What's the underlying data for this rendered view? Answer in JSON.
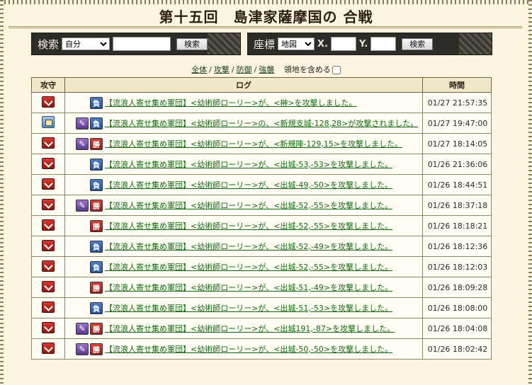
{
  "title": "第十五回　島津家薩摩国の 合戦",
  "search": {
    "label": "検索",
    "select_value": "自分",
    "select_options": [
      "自分"
    ],
    "text_value": "",
    "button": "検索"
  },
  "coords": {
    "label": "座標",
    "select_value": "地図",
    "select_options": [
      "地図"
    ],
    "x_label": "X.",
    "x_value": "",
    "y_label": "Y.",
    "y_value": "",
    "button": "検索"
  },
  "filters": {
    "all": "全体",
    "attack": "攻撃",
    "defense": "防御",
    "recon": "強襲",
    "include_territory": "領地を含める",
    "sep": "/"
  },
  "table": {
    "headers": {
      "kind": "攻守",
      "log": "ログ",
      "time": "時間"
    },
    "rows": [
      {
        "kind": "attack",
        "badges": [
          "負"
        ],
        "text": "【流浪人寄せ集め軍団】<幼術師ローリー>が、<榊>を攻撃しました。",
        "time": "01/27 21:57:35"
      },
      {
        "kind": "defense",
        "badges": [
          "feather",
          "負"
        ],
        "text": "【流浪人寄せ集め軍団】<幼術師ローリー>の、<新規支城-128,28>が攻撃されました。",
        "time": "01/27 19:47:00"
      },
      {
        "kind": "attack",
        "badges": [
          "feather",
          "勝"
        ],
        "text": "【流浪人寄せ集め軍団】<幼術師ローリー>が、<新規陣-129,15>を攻撃しました。",
        "time": "01/27 18:14:05"
      },
      {
        "kind": "attack",
        "badges": [
          "負"
        ],
        "text": "【流浪人寄せ集め軍団】<幼術師ローリー>が、<出城-53,-53>を攻撃しました。",
        "time": "01/26 21:36:06"
      },
      {
        "kind": "attack",
        "badges": [
          "負"
        ],
        "text": "【流浪人寄せ集め軍団】<幼術師ローリー>が、<出城-49,-50>を攻撃しました。",
        "time": "01/26 18:44:51"
      },
      {
        "kind": "attack",
        "badges": [
          "feather",
          "勝"
        ],
        "text": "【流浪人寄せ集め軍団】<幼術師ローリー>が、<出城-52,-55>を攻撃しました。",
        "time": "01/26 18:37:18"
      },
      {
        "kind": "attack",
        "badges": [
          "勝"
        ],
        "text": "【流浪人寄せ集め軍団】<幼術師ローリー>が、<出城-52,-55>を攻撃しました。",
        "time": "01/26 18:18:21"
      },
      {
        "kind": "attack",
        "badges": [
          "負"
        ],
        "text": "【流浪人寄せ集め軍団】<幼術師ローリー>が、<出城-52,-49>を攻撃しました。",
        "time": "01/26 18:12:36"
      },
      {
        "kind": "attack",
        "badges": [
          "負"
        ],
        "text": "【流浪人寄せ集め軍団】<幼術師ローリー>が、<出城-52,-55>を攻撃しました。",
        "time": "01/26 18:12:03"
      },
      {
        "kind": "attack",
        "badges": [
          "勝"
        ],
        "text": "【流浪人寄せ集め軍団】<幼術師ローリー>が、<出城-51,-49>を攻撃しました。",
        "time": "01/26 18:09:28"
      },
      {
        "kind": "attack",
        "badges": [
          "負"
        ],
        "text": "【流浪人寄せ集め軍団】<幼術師ローリー>が、<出城-51,-53>を攻撃しました。",
        "time": "01/26 18:08:00"
      },
      {
        "kind": "attack",
        "badges": [
          "feather",
          "勝"
        ],
        "text": "【流浪人寄せ集め軍団】<幼術師ローリー>が、<出城191,-87>を攻撃しました。",
        "time": "01/26 18:04:08"
      },
      {
        "kind": "attack",
        "badges": [
          "feather",
          "勝"
        ],
        "text": "【流浪人寄せ集め軍団】<幼術師ローリー>が、<出城-50,-50>を攻撃しました。",
        "time": "01/26 18:02:42"
      }
    ]
  },
  "colors": {
    "background": "#fbf5e0",
    "link_green": "#126b12",
    "header_bg": "#f0e8c8",
    "bar_bg": "#2e2c27",
    "win_red": "#d2433a",
    "lose_blue": "#4f7fc8",
    "feather_purple": "#9b72c8"
  },
  "icons": {
    "attack": "crossed-swords-red-icon",
    "defense": "castle-shield-blue-icon",
    "feather": "feather-icon"
  }
}
